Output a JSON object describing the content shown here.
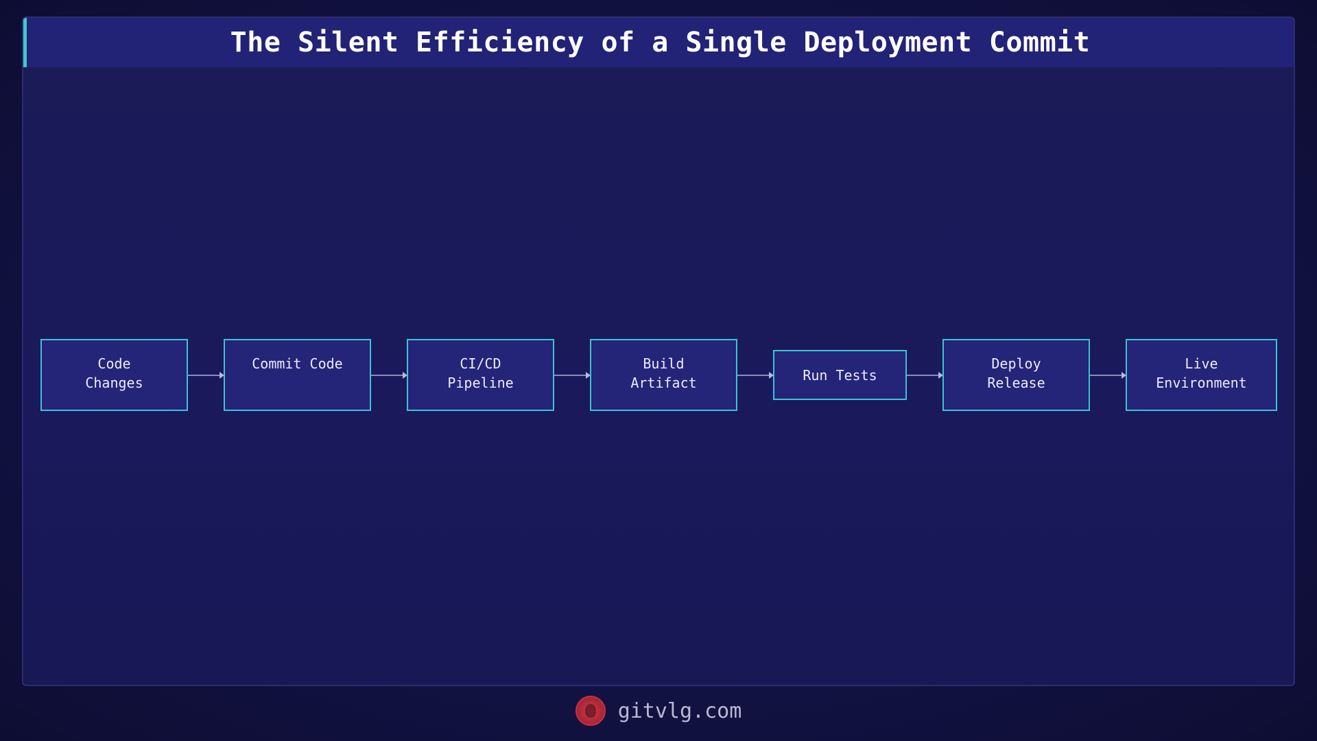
{
  "title": "The Silent Efficiency of a Single Deployment Commit",
  "nodes": [
    {
      "id": "code-changes",
      "label": "Code\nChanges"
    },
    {
      "id": "commit-code",
      "label": "Commit Code"
    },
    {
      "id": "ci-cd-pipeline",
      "label": "CI/CD\nPipeline"
    },
    {
      "id": "build-artifact",
      "label": "Build\nArtifact"
    },
    {
      "id": "run-tests",
      "label": "Run Tests"
    },
    {
      "id": "deploy-release",
      "label": "Deploy\nRelease"
    },
    {
      "id": "live-environment",
      "label": "Live\nEnvironment"
    }
  ],
  "edges": [
    {
      "from": "code-changes",
      "to": "commit-code"
    },
    {
      "from": "commit-code",
      "to": "ci-cd-pipeline"
    },
    {
      "from": "ci-cd-pipeline",
      "to": "build-artifact"
    },
    {
      "from": "build-artifact",
      "to": "run-tests"
    },
    {
      "from": "run-tests",
      "to": "deploy-release"
    },
    {
      "from": "deploy-release",
      "to": "live-environment"
    }
  ],
  "footer": {
    "logo_icon": "lion-logo-icon",
    "site": "gitvlg.com"
  },
  "colors": {
    "background": "#131345",
    "panel": "#1b1b56",
    "title_bar": "#222277",
    "accent": "#3ec9c9",
    "node_fill": "#242478",
    "node_border": "#3cc4d4",
    "logo": "#d13a4a"
  }
}
